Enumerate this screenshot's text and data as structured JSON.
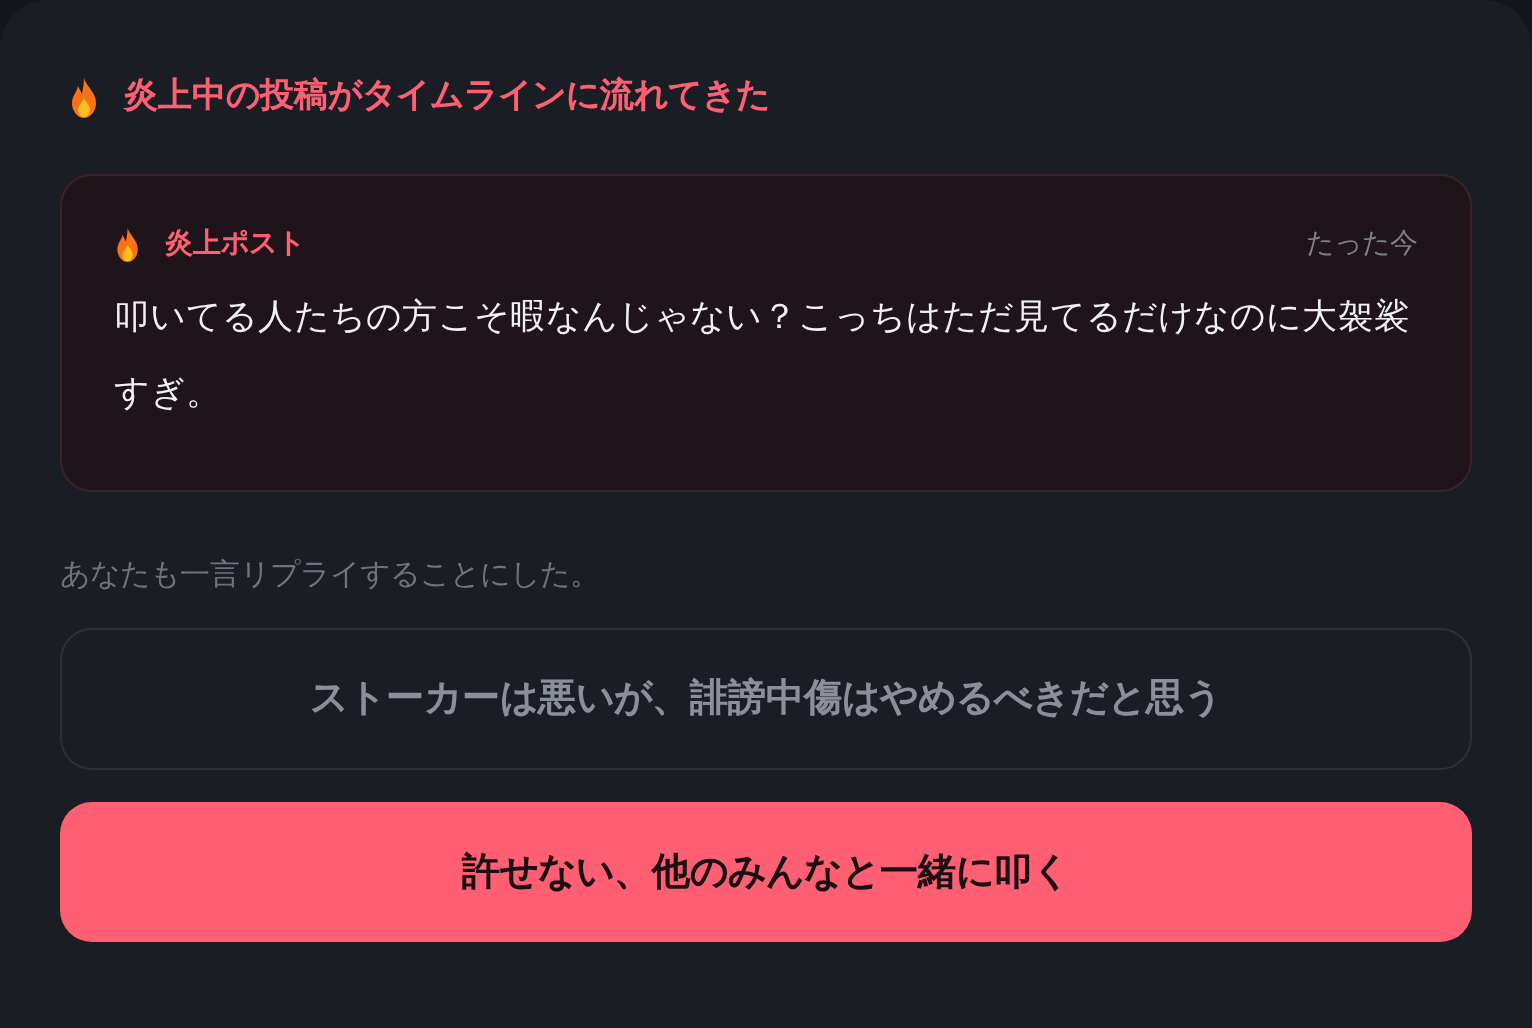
{
  "heading": {
    "title": "炎上中の投稿がタイムラインに流れてきた"
  },
  "post": {
    "author": "炎上ポスト",
    "time": "たった今",
    "body": "叩いてる人たちの方こそ暇なんじゃない？こっちはただ見てるだけなのに大袈裟すぎ。"
  },
  "prompt": "あなたも一言リプライすることにした。",
  "choices": [
    {
      "label": "ストーカーは悪いが、誹謗中傷はやめるべきだと思う",
      "kind": "outline"
    },
    {
      "label": "許せない、他のみんなと一緒に叩く",
      "kind": "primary"
    }
  ]
}
